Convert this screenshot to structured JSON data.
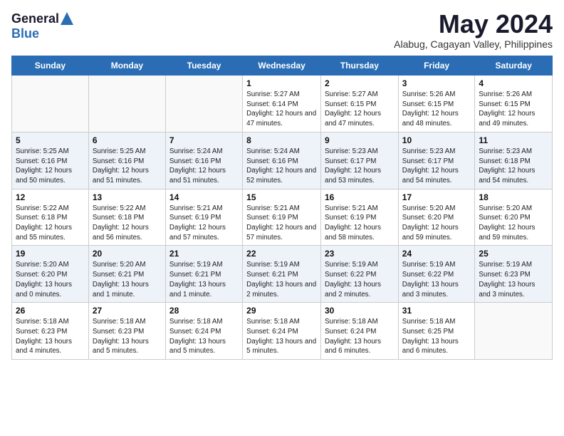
{
  "logo": {
    "general": "General",
    "blue": "Blue"
  },
  "title": "May 2024",
  "location": "Alabug, Cagayan Valley, Philippines",
  "days_of_week": [
    "Sunday",
    "Monday",
    "Tuesday",
    "Wednesday",
    "Thursday",
    "Friday",
    "Saturday"
  ],
  "weeks": [
    [
      {
        "num": "",
        "info": ""
      },
      {
        "num": "",
        "info": ""
      },
      {
        "num": "",
        "info": ""
      },
      {
        "num": "1",
        "info": "Sunrise: 5:27 AM\nSunset: 6:14 PM\nDaylight: 12 hours and 47 minutes."
      },
      {
        "num": "2",
        "info": "Sunrise: 5:27 AM\nSunset: 6:15 PM\nDaylight: 12 hours and 47 minutes."
      },
      {
        "num": "3",
        "info": "Sunrise: 5:26 AM\nSunset: 6:15 PM\nDaylight: 12 hours and 48 minutes."
      },
      {
        "num": "4",
        "info": "Sunrise: 5:26 AM\nSunset: 6:15 PM\nDaylight: 12 hours and 49 minutes."
      }
    ],
    [
      {
        "num": "5",
        "info": "Sunrise: 5:25 AM\nSunset: 6:16 PM\nDaylight: 12 hours and 50 minutes."
      },
      {
        "num": "6",
        "info": "Sunrise: 5:25 AM\nSunset: 6:16 PM\nDaylight: 12 hours and 51 minutes."
      },
      {
        "num": "7",
        "info": "Sunrise: 5:24 AM\nSunset: 6:16 PM\nDaylight: 12 hours and 51 minutes."
      },
      {
        "num": "8",
        "info": "Sunrise: 5:24 AM\nSunset: 6:16 PM\nDaylight: 12 hours and 52 minutes."
      },
      {
        "num": "9",
        "info": "Sunrise: 5:23 AM\nSunset: 6:17 PM\nDaylight: 12 hours and 53 minutes."
      },
      {
        "num": "10",
        "info": "Sunrise: 5:23 AM\nSunset: 6:17 PM\nDaylight: 12 hours and 54 minutes."
      },
      {
        "num": "11",
        "info": "Sunrise: 5:23 AM\nSunset: 6:18 PM\nDaylight: 12 hours and 54 minutes."
      }
    ],
    [
      {
        "num": "12",
        "info": "Sunrise: 5:22 AM\nSunset: 6:18 PM\nDaylight: 12 hours and 55 minutes."
      },
      {
        "num": "13",
        "info": "Sunrise: 5:22 AM\nSunset: 6:18 PM\nDaylight: 12 hours and 56 minutes."
      },
      {
        "num": "14",
        "info": "Sunrise: 5:21 AM\nSunset: 6:19 PM\nDaylight: 12 hours and 57 minutes."
      },
      {
        "num": "15",
        "info": "Sunrise: 5:21 AM\nSunset: 6:19 PM\nDaylight: 12 hours and 57 minutes."
      },
      {
        "num": "16",
        "info": "Sunrise: 5:21 AM\nSunset: 6:19 PM\nDaylight: 12 hours and 58 minutes."
      },
      {
        "num": "17",
        "info": "Sunrise: 5:20 AM\nSunset: 6:20 PM\nDaylight: 12 hours and 59 minutes."
      },
      {
        "num": "18",
        "info": "Sunrise: 5:20 AM\nSunset: 6:20 PM\nDaylight: 12 hours and 59 minutes."
      }
    ],
    [
      {
        "num": "19",
        "info": "Sunrise: 5:20 AM\nSunset: 6:20 PM\nDaylight: 13 hours and 0 minutes."
      },
      {
        "num": "20",
        "info": "Sunrise: 5:20 AM\nSunset: 6:21 PM\nDaylight: 13 hours and 1 minute."
      },
      {
        "num": "21",
        "info": "Sunrise: 5:19 AM\nSunset: 6:21 PM\nDaylight: 13 hours and 1 minute."
      },
      {
        "num": "22",
        "info": "Sunrise: 5:19 AM\nSunset: 6:21 PM\nDaylight: 13 hours and 2 minutes."
      },
      {
        "num": "23",
        "info": "Sunrise: 5:19 AM\nSunset: 6:22 PM\nDaylight: 13 hours and 2 minutes."
      },
      {
        "num": "24",
        "info": "Sunrise: 5:19 AM\nSunset: 6:22 PM\nDaylight: 13 hours and 3 minutes."
      },
      {
        "num": "25",
        "info": "Sunrise: 5:19 AM\nSunset: 6:23 PM\nDaylight: 13 hours and 3 minutes."
      }
    ],
    [
      {
        "num": "26",
        "info": "Sunrise: 5:18 AM\nSunset: 6:23 PM\nDaylight: 13 hours and 4 minutes."
      },
      {
        "num": "27",
        "info": "Sunrise: 5:18 AM\nSunset: 6:23 PM\nDaylight: 13 hours and 5 minutes."
      },
      {
        "num": "28",
        "info": "Sunrise: 5:18 AM\nSunset: 6:24 PM\nDaylight: 13 hours and 5 minutes."
      },
      {
        "num": "29",
        "info": "Sunrise: 5:18 AM\nSunset: 6:24 PM\nDaylight: 13 hours and 5 minutes."
      },
      {
        "num": "30",
        "info": "Sunrise: 5:18 AM\nSunset: 6:24 PM\nDaylight: 13 hours and 6 minutes."
      },
      {
        "num": "31",
        "info": "Sunrise: 5:18 AM\nSunset: 6:25 PM\nDaylight: 13 hours and 6 minutes."
      },
      {
        "num": "",
        "info": ""
      }
    ]
  ]
}
